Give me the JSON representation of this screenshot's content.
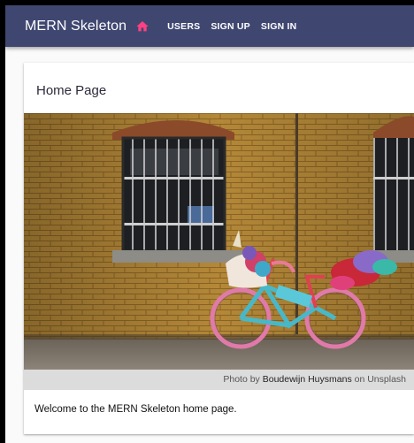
{
  "appbar": {
    "title": "MERN Skeleton",
    "home_icon": "home-icon",
    "links": [
      "USERS",
      "SIGN UP",
      "SIGN IN"
    ],
    "accent_color": "#ff4081",
    "bar_color": "#3f4771"
  },
  "card": {
    "title": "Home Page",
    "image_icon": "unicorn-bicycle-photo",
    "caption": {
      "prefix": "Photo by",
      "author": "Boudewijn Huysmans",
      "suffix": "on Unsplash"
    },
    "welcome_text": "Welcome to the MERN Skeleton home page."
  }
}
